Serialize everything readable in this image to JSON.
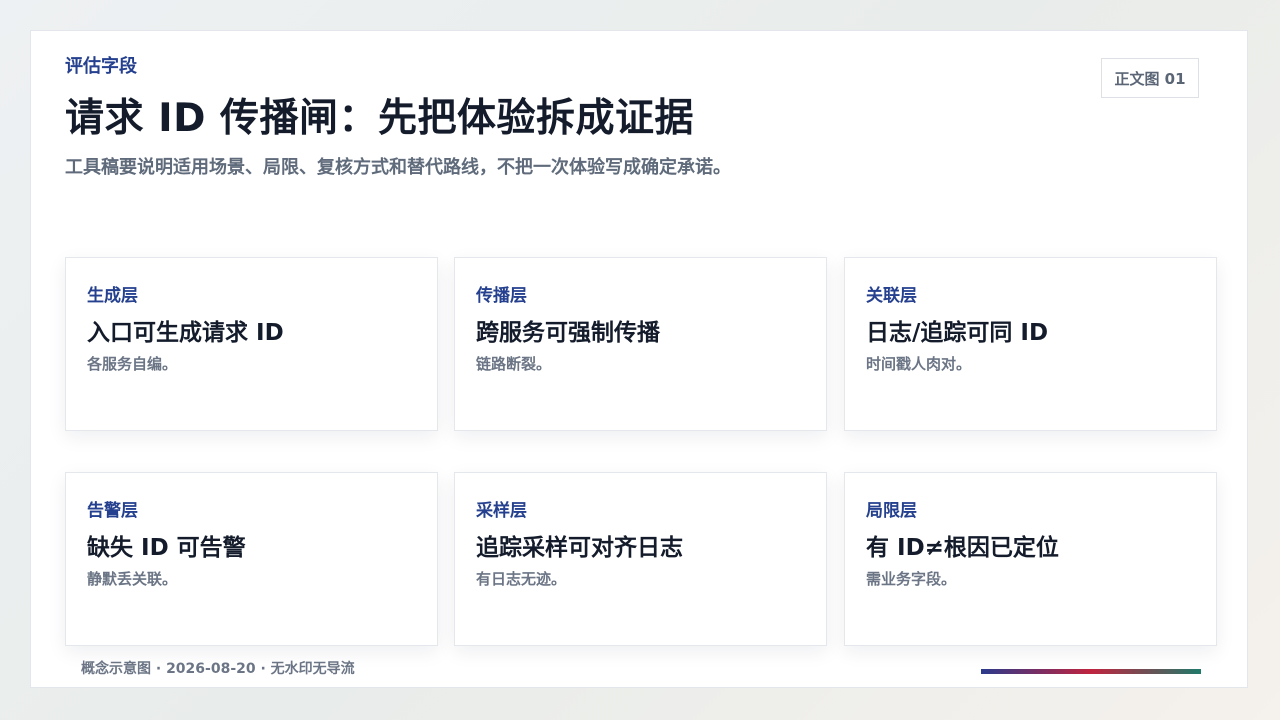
{
  "header": {
    "kicker": "评估字段",
    "title": "请求 ID 传播闸：先把体验拆成证据",
    "subtitle": "工具稿要说明适用场景、局限、复核方式和替代路线，不把一次体验写成确定承诺。",
    "badge": "正文图 01"
  },
  "cards": [
    {
      "layer": "生成层",
      "heading": "入口可生成请求 ID",
      "note": "各服务自编。"
    },
    {
      "layer": "传播层",
      "heading": "跨服务可强制传播",
      "note": "链路断裂。"
    },
    {
      "layer": "关联层",
      "heading": "日志/追踪可同 ID",
      "note": "时间戳人肉对。"
    },
    {
      "layer": "告警层",
      "heading": "缺失 ID 可告警",
      "note": "静默丢关联。"
    },
    {
      "layer": "采样层",
      "heading": "追踪采样可对齐日志",
      "note": "有日志无迹。"
    },
    {
      "layer": "局限层",
      "heading": "有 ID≠根因已定位",
      "note": "需业务字段。"
    }
  ],
  "footer": {
    "text": "概念示意图 · 2026-08-20 · 无水印无导流"
  },
  "colors": {
    "accent_blue": "#24408e",
    "title_dark": "#141c2c",
    "muted_gray": "#6b7585",
    "bar_start": "#2b3a8c",
    "bar_mid": "#c0243f",
    "bar_end": "#1f7a6a"
  }
}
